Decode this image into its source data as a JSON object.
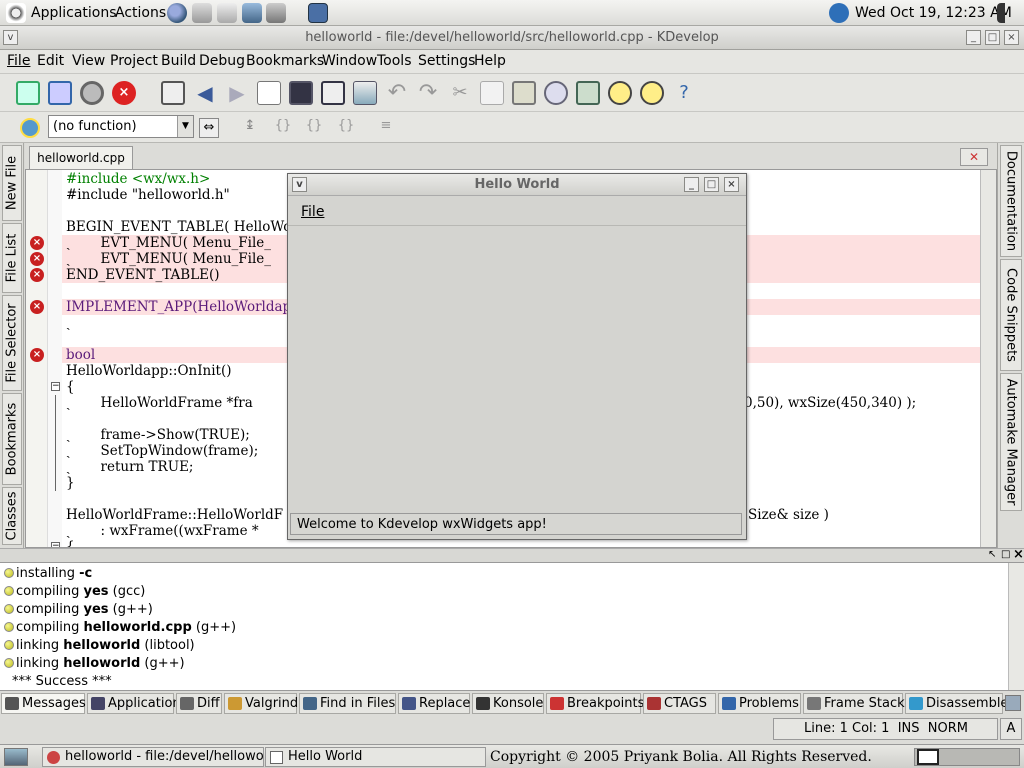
{
  "top_panel": {
    "applications": "Applications",
    "actions": "Actions",
    "clock": "Wed Oct 19, 12:23 AM"
  },
  "window": {
    "title": "helloworld - file:/devel/helloworld/src/helloworld.cpp - KDevelop"
  },
  "menu": {
    "file": "File",
    "edit": "Edit",
    "view": "View",
    "project": "Project",
    "build": "Build",
    "debug": "Debug",
    "bookmarks": "Bookmarks",
    "window": "Window",
    "tools": "Tools",
    "settings": "Settings",
    "help": "Help"
  },
  "toolbar2": {
    "function_select": "(no function)"
  },
  "left_tabs": [
    "New File",
    "File List",
    "File Selector",
    "Bookmarks",
    "Classes"
  ],
  "right_tabs": [
    "Documentation",
    "Code Snippets",
    "Automake Manager"
  ],
  "editor": {
    "tab": "helloworld.cpp",
    "lines": [
      {
        "t": "#include <wx/wx.h>",
        "cls": "pp",
        "err": false
      },
      {
        "t": "#include \"helloworld.h\"",
        "cls": "",
        "err": false
      },
      {
        "t": "",
        "cls": "",
        "err": false
      },
      {
        "t": "BEGIN_EVENT_TABLE( HelloWorl",
        "cls": "",
        "err": false
      },
      {
        "t": "ˎ       EVT_MENU( Menu_File_",
        "cls": "",
        "err": true
      },
      {
        "t": "ˎ       EVT_MENU( Menu_File_",
        "cls": "",
        "err": true
      },
      {
        "t": "END_EVENT_TABLE()",
        "cls": "",
        "err": true
      },
      {
        "t": "",
        "cls": "",
        "err": false
      },
      {
        "t": "IMPLEMENT_APP(HelloWorldapp)",
        "cls": "pu",
        "err": true
      },
      {
        "t": "ˎ",
        "cls": "",
        "err": false
      },
      {
        "t": "",
        "cls": "",
        "err": false
      },
      {
        "t": "bool",
        "cls": "pu",
        "err": true
      },
      {
        "t": "HelloWorldapp::OnInit()",
        "cls": "",
        "err": false
      },
      {
        "t": "{",
        "cls": "",
        "err": false
      },
      {
        "t": "ˎ       HelloWorldFrame *fra",
        "cls": "",
        "err": false
      },
      {
        "t": "",
        "cls": "",
        "err": false
      },
      {
        "t": "ˎ       frame->Show(TRUE);",
        "cls": "",
        "err": false
      },
      {
        "t": "ˎ       SetTopWindow(frame);",
        "cls": "",
        "err": false
      },
      {
        "t": "ˎ       return TRUE;",
        "cls": "",
        "err": false
      },
      {
        "t": "}",
        "cls": "",
        "err": false
      },
      {
        "t": "",
        "cls": "",
        "err": false
      },
      {
        "t": "HelloWorldFrame::HelloWorldF",
        "cls": "",
        "err": false
      },
      {
        "t": "ˎ       : wxFrame((wxFrame *",
        "cls": "",
        "err": false
      },
      {
        "t": "{",
        "cls": "",
        "err": false
      }
    ],
    "overflow_line15": "0,50), wxSize(450,340) );",
    "overflow_line22": "Size& size )"
  },
  "dialog": {
    "title": "Hello World",
    "menu_file": "File",
    "status": "Welcome to Kdevelop wxWidgets app!"
  },
  "messages": [
    {
      "pre": "installing ",
      "bold": "-c",
      "post": ""
    },
    {
      "pre": "compiling ",
      "bold": "yes",
      "post": " (gcc)"
    },
    {
      "pre": "compiling ",
      "bold": "yes",
      "post": " (g++)"
    },
    {
      "pre": "compiling ",
      "bold": "helloworld.cpp",
      "post": " (g++)"
    },
    {
      "pre": "linking ",
      "bold": "helloworld",
      "post": " (libtool)"
    },
    {
      "pre": "linking ",
      "bold": "helloworld",
      "post": " (g++)"
    },
    {
      "pre": "*** Success ***",
      "bold": "",
      "post": "",
      "nodot": true
    }
  ],
  "bottom_tabs": [
    "Messages",
    "Application",
    "Diff",
    "Valgrind",
    "Find in Files",
    "Replace",
    "Konsole",
    "Breakpoints",
    "CTAGS",
    "Problems",
    "Frame Stack",
    "Disassemble"
  ],
  "status": {
    "text": "Line: 1 Col: 1  INS  NORM",
    "mode": "A"
  },
  "taskbar": {
    "task1": "helloworld - file:/devel/helloworld/s",
    "task2": "Hello World",
    "copyright": "Copyright © 2005 Priyank Bolia. All Rights Reserved."
  }
}
